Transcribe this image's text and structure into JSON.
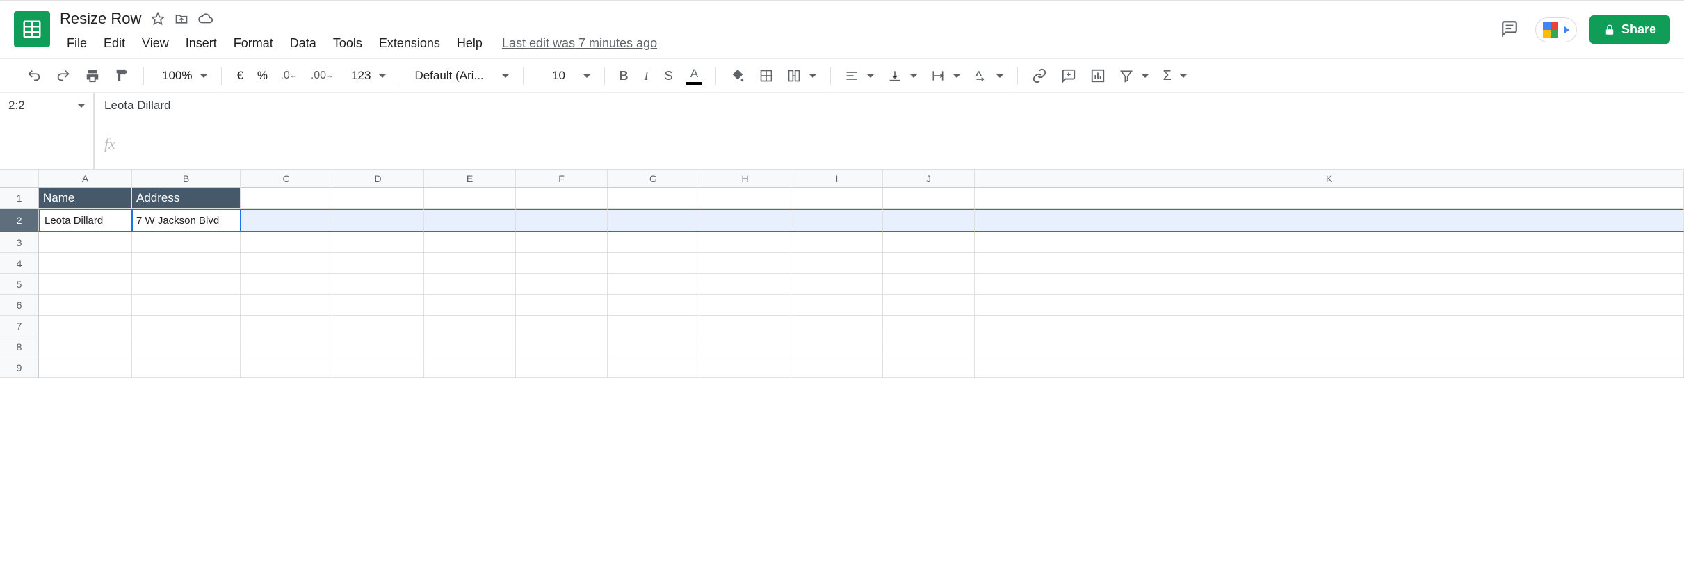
{
  "doc": {
    "title": "Resize Row"
  },
  "menus": [
    "File",
    "Edit",
    "View",
    "Insert",
    "Format",
    "Data",
    "Tools",
    "Extensions",
    "Help"
  ],
  "last_edit": "Last edit was 7 minutes ago",
  "share_label": "Share",
  "toolbar": {
    "zoom": "100%",
    "currency": "€",
    "percent": "%",
    "dec_dec": ".0",
    "inc_dec": ".00",
    "num_fmt": "123",
    "font": "Default (Ari...",
    "font_size": "10"
  },
  "namebox": "2:2",
  "formula_value": "Leota Dillard",
  "columns": [
    "A",
    "B",
    "C",
    "D",
    "E",
    "F",
    "G",
    "H",
    "I",
    "J",
    "K"
  ],
  "rows": [
    "1",
    "2",
    "3",
    "4",
    "5",
    "6",
    "7",
    "8",
    "9"
  ],
  "sheet": {
    "r1": {
      "A": "Name",
      "B": "Address"
    },
    "r2": {
      "A": "Leota Dillard",
      "B": "7 W Jackson Blvd"
    }
  }
}
